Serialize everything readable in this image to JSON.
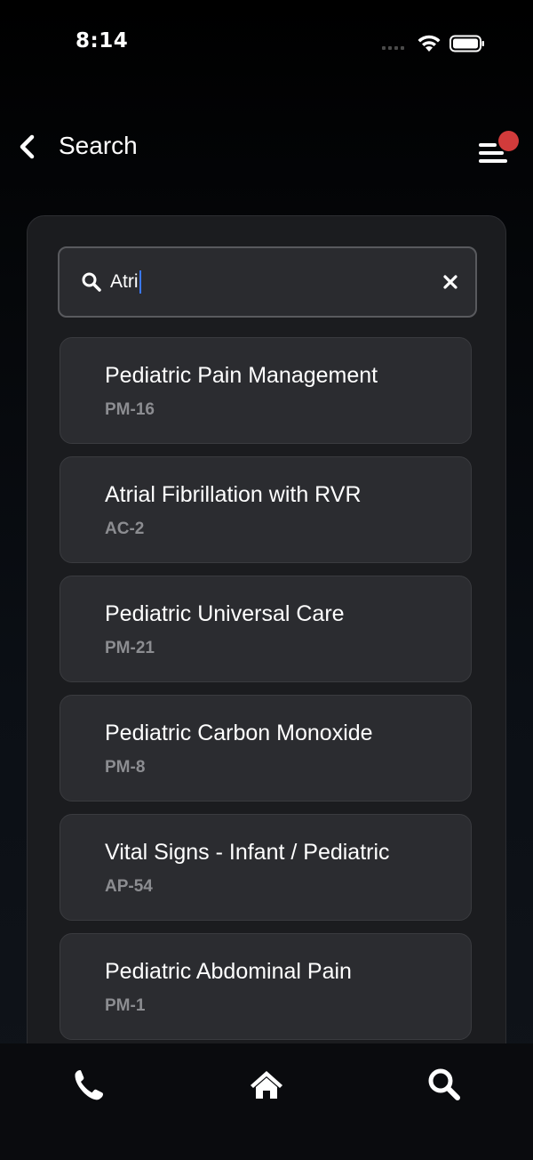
{
  "status_bar": {
    "time": "8:14"
  },
  "header": {
    "title": "Search",
    "back_icon": "chevron-left-icon",
    "menu_icon": "menu-icon",
    "notification_color": "#d23b3b"
  },
  "search": {
    "value": "Atri",
    "icon": "search-icon",
    "clear_icon": "close-icon"
  },
  "results": [
    {
      "title": "Pediatric Pain Management",
      "code": "PM-16"
    },
    {
      "title": "Atrial Fibrillation with RVR",
      "code": "AC-2"
    },
    {
      "title": "Pediatric Universal Care",
      "code": "PM-21"
    },
    {
      "title": "Pediatric Carbon Monoxide",
      "code": "PM-8"
    },
    {
      "title": "Vital Signs - Infant / Pediatric",
      "code": "AP-54"
    },
    {
      "title": "Pediatric Abdominal Pain",
      "code": "PM-1"
    }
  ],
  "tab_bar": {
    "items": [
      {
        "icon": "phone-icon"
      },
      {
        "icon": "home-icon"
      },
      {
        "icon": "search-icon"
      }
    ]
  },
  "colors": {
    "card_bg": "#2b2c30",
    "code_text": "#8c8d91",
    "caret": "#3a78ff"
  }
}
